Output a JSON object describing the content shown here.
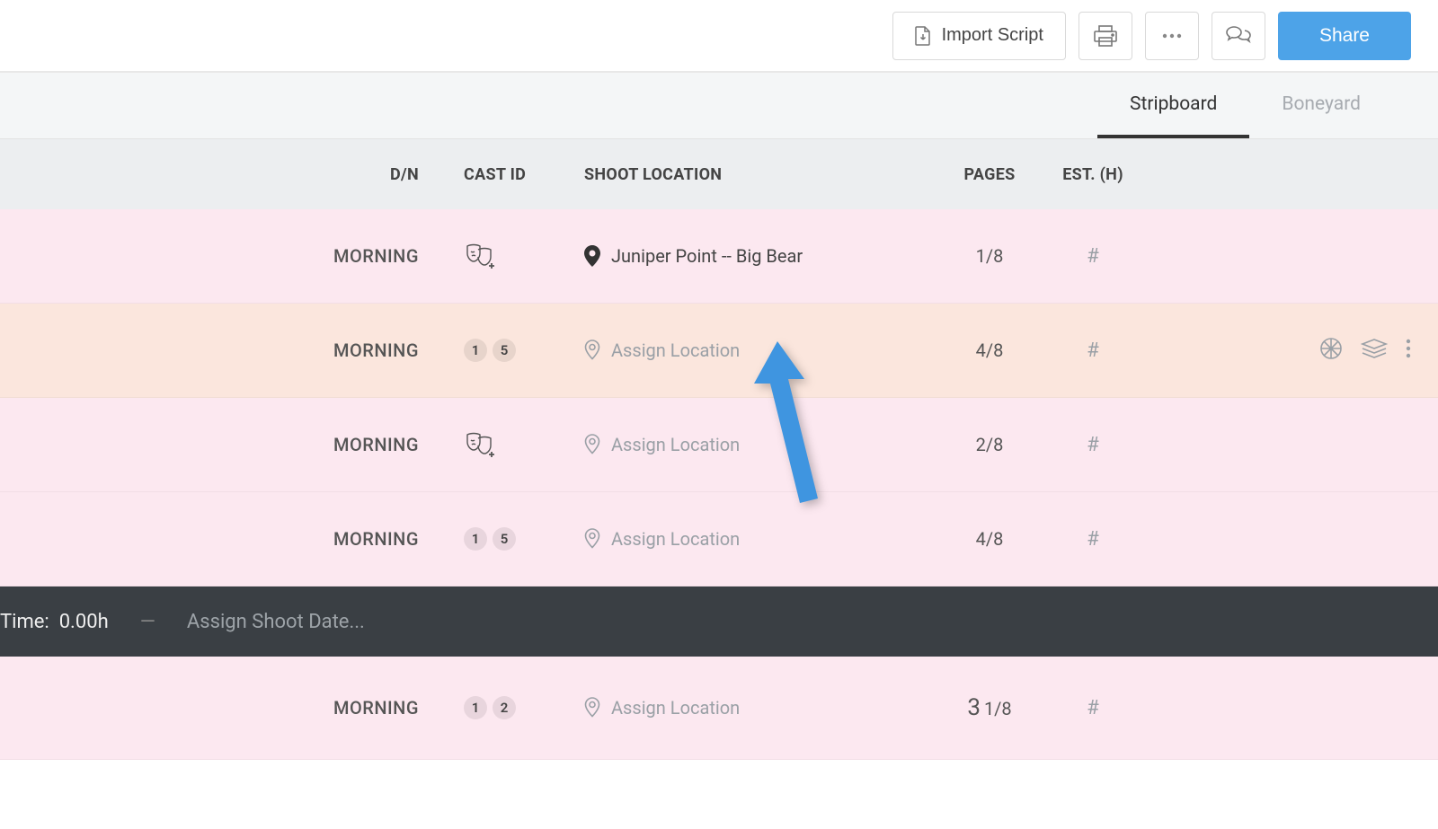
{
  "toolbar": {
    "import_label": "Import Script",
    "share_label": "Share"
  },
  "tabs": {
    "stripboard": "Stripboard",
    "boneyard": "Boneyard"
  },
  "columns": {
    "dn": "D/N",
    "cast": "CAST ID",
    "location": "SHOOT LOCATION",
    "pages": "PAGES",
    "est": "EST. (H)"
  },
  "strips": [
    {
      "dn": "MORNING",
      "cast": [],
      "cast_icon": true,
      "location_assigned": true,
      "location": "Juniper Point -- Big Bear",
      "pages": "1/8",
      "est": "#",
      "variant": "pink",
      "hover": false
    },
    {
      "dn": "MORNING",
      "cast": [
        "1",
        "5"
      ],
      "cast_icon": false,
      "location_assigned": false,
      "location": "Assign Location",
      "pages": "4/8",
      "est": "#",
      "variant": "peach",
      "hover": true
    },
    {
      "dn": "MORNING",
      "cast": [],
      "cast_icon": true,
      "location_assigned": false,
      "location": "Assign Location",
      "pages": "2/8",
      "est": "#",
      "variant": "pink",
      "hover": false
    },
    {
      "dn": "MORNING",
      "cast": [
        "1",
        "5"
      ],
      "cast_icon": false,
      "location_assigned": false,
      "location": "Assign Location",
      "pages": "4/8",
      "est": "#",
      "variant": "pink",
      "hover": false
    }
  ],
  "daybar": {
    "time_label": "Time:",
    "time_value": "0.00h",
    "assign_date": "Assign Shoot Date..."
  },
  "strip_after": {
    "dn": "MORNING",
    "cast": [
      "1",
      "2"
    ],
    "location": "Assign Location",
    "pages_big": "3",
    "pages_frac": "1/8",
    "est": "#"
  }
}
